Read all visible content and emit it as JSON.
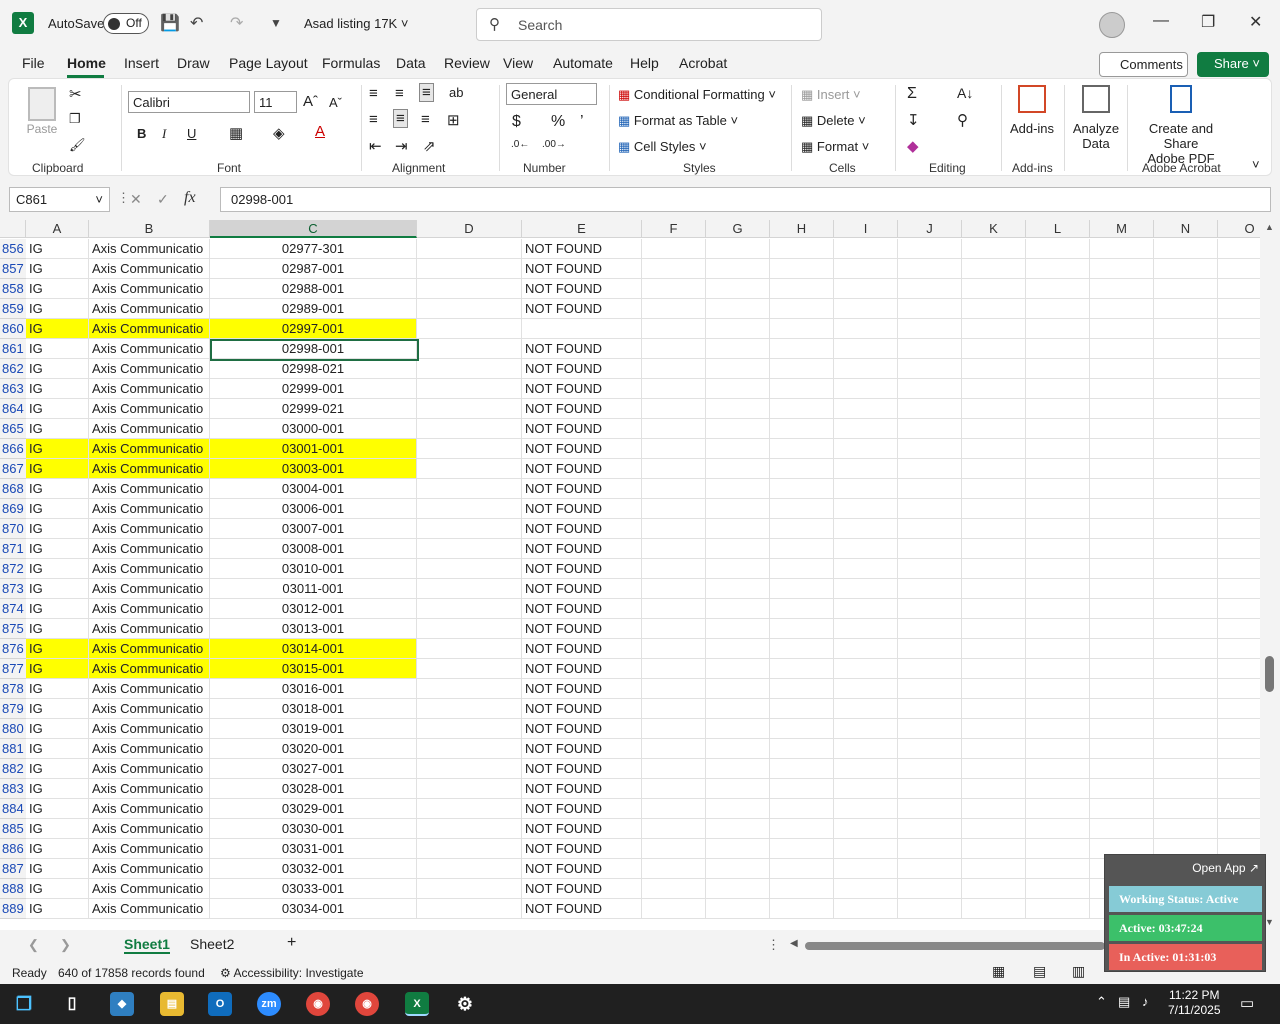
{
  "titlebar": {
    "autosave_label": "AutoSave",
    "autosave_state": "Off",
    "doc_name": "Asad listing 17K",
    "search_placeholder": "Search"
  },
  "menu": [
    "File",
    "Home",
    "Insert",
    "Draw",
    "Page Layout",
    "Formulas",
    "Data",
    "Review",
    "View",
    "Automate",
    "Help",
    "Acrobat"
  ],
  "actions": {
    "comments": "Comments",
    "share": "Share"
  },
  "ribbon": {
    "clipboard": {
      "paste": "Paste",
      "label": "Clipboard"
    },
    "font": {
      "name": "Calibri",
      "size": "11",
      "label": "Font",
      "bold": "B",
      "italic": "I",
      "underline": "U"
    },
    "alignment": {
      "label": "Alignment"
    },
    "number": {
      "format": "General",
      "label": "Number"
    },
    "styles": {
      "conditional": "Conditional Formatting",
      "table": "Format as Table",
      "cell_styles": "Cell Styles",
      "label": "Styles"
    },
    "cells": {
      "insert": "Insert",
      "delete": "Delete",
      "format": "Format",
      "label": "Cells"
    },
    "editing": {
      "label": "Editing"
    },
    "addins": {
      "button": "Add-ins",
      "label": "Add-ins"
    },
    "analyze": {
      "line1": "Analyze",
      "line2": "Data"
    },
    "acrobat": {
      "line1": "Create and Share",
      "line2": "Adobe PDF",
      "label": "Adobe Acrobat"
    }
  },
  "formula": {
    "name_box": "C861",
    "value": "02998-001"
  },
  "columns": [
    "A",
    "B",
    "C",
    "D",
    "E",
    "F",
    "G",
    "H",
    "I",
    "J",
    "K",
    "L",
    "M",
    "N",
    "O"
  ],
  "rows": [
    {
      "n": "856",
      "a": "IG",
      "b": "Axis Communicatio",
      "c": "02977-301",
      "e": "NOT FOUND",
      "hl": false
    },
    {
      "n": "857",
      "a": "IG",
      "b": "Axis Communicatio",
      "c": "02987-001",
      "e": "NOT FOUND",
      "hl": false
    },
    {
      "n": "858",
      "a": "IG",
      "b": "Axis Communicatio",
      "c": "02988-001",
      "e": "NOT FOUND",
      "hl": false
    },
    {
      "n": "859",
      "a": "IG",
      "b": "Axis Communicatio",
      "c": "02989-001",
      "e": "NOT FOUND",
      "hl": false
    },
    {
      "n": "860",
      "a": "IG",
      "b": "Axis Communicatio",
      "c": "02997-001",
      "e": "",
      "hl": true
    },
    {
      "n": "861",
      "a": "IG",
      "b": "Axis Communicatio",
      "c": "02998-001",
      "e": "NOT FOUND",
      "hl": false
    },
    {
      "n": "862",
      "a": "IG",
      "b": "Axis Communicatio",
      "c": "02998-021",
      "e": "NOT FOUND",
      "hl": false
    },
    {
      "n": "863",
      "a": "IG",
      "b": "Axis Communicatio",
      "c": "02999-001",
      "e": "NOT FOUND",
      "hl": false
    },
    {
      "n": "864",
      "a": "IG",
      "b": "Axis Communicatio",
      "c": "02999-021",
      "e": "NOT FOUND",
      "hl": false
    },
    {
      "n": "865",
      "a": "IG",
      "b": "Axis Communicatio",
      "c": "03000-001",
      "e": "NOT FOUND",
      "hl": false
    },
    {
      "n": "866",
      "a": "IG",
      "b": "Axis Communicatio",
      "c": "03001-001",
      "e": "NOT FOUND",
      "hl": true
    },
    {
      "n": "867",
      "a": "IG",
      "b": "Axis Communicatio",
      "c": "03003-001",
      "e": "NOT FOUND",
      "hl": true
    },
    {
      "n": "868",
      "a": "IG",
      "b": "Axis Communicatio",
      "c": "03004-001",
      "e": "NOT FOUND",
      "hl": false
    },
    {
      "n": "869",
      "a": "IG",
      "b": "Axis Communicatio",
      "c": "03006-001",
      "e": "NOT FOUND",
      "hl": false
    },
    {
      "n": "870",
      "a": "IG",
      "b": "Axis Communicatio",
      "c": "03007-001",
      "e": "NOT FOUND",
      "hl": false
    },
    {
      "n": "871",
      "a": "IG",
      "b": "Axis Communicatio",
      "c": "03008-001",
      "e": "NOT FOUND",
      "hl": false
    },
    {
      "n": "872",
      "a": "IG",
      "b": "Axis Communicatio",
      "c": "03010-001",
      "e": "NOT FOUND",
      "hl": false
    },
    {
      "n": "873",
      "a": "IG",
      "b": "Axis Communicatio",
      "c": "03011-001",
      "e": "NOT FOUND",
      "hl": false
    },
    {
      "n": "874",
      "a": "IG",
      "b": "Axis Communicatio",
      "c": "03012-001",
      "e": "NOT FOUND",
      "hl": false
    },
    {
      "n": "875",
      "a": "IG",
      "b": "Axis Communicatio",
      "c": "03013-001",
      "e": "NOT FOUND",
      "hl": false
    },
    {
      "n": "876",
      "a": "IG",
      "b": "Axis Communicatio",
      "c": "03014-001",
      "e": "NOT FOUND",
      "hl": true
    },
    {
      "n": "877",
      "a": "IG",
      "b": "Axis Communicatio",
      "c": "03015-001",
      "e": "NOT FOUND",
      "hl": true
    },
    {
      "n": "878",
      "a": "IG",
      "b": "Axis Communicatio",
      "c": "03016-001",
      "e": "NOT FOUND",
      "hl": false
    },
    {
      "n": "879",
      "a": "IG",
      "b": "Axis Communicatio",
      "c": "03018-001",
      "e": "NOT FOUND",
      "hl": false
    },
    {
      "n": "880",
      "a": "IG",
      "b": "Axis Communicatio",
      "c": "03019-001",
      "e": "NOT FOUND",
      "hl": false
    },
    {
      "n": "881",
      "a": "IG",
      "b": "Axis Communicatio",
      "c": "03020-001",
      "e": "NOT FOUND",
      "hl": false
    },
    {
      "n": "882",
      "a": "IG",
      "b": "Axis Communicatio",
      "c": "03027-001",
      "e": "NOT FOUND",
      "hl": false
    },
    {
      "n": "883",
      "a": "IG",
      "b": "Axis Communicatio",
      "c": "03028-001",
      "e": "NOT FOUND",
      "hl": false
    },
    {
      "n": "884",
      "a": "IG",
      "b": "Axis Communicatio",
      "c": "03029-001",
      "e": "NOT FOUND",
      "hl": false
    },
    {
      "n": "885",
      "a": "IG",
      "b": "Axis Communicatio",
      "c": "03030-001",
      "e": "NOT FOUND",
      "hl": false
    },
    {
      "n": "886",
      "a": "IG",
      "b": "Axis Communicatio",
      "c": "03031-001",
      "e": "NOT FOUND",
      "hl": false
    },
    {
      "n": "887",
      "a": "IG",
      "b": "Axis Communicatio",
      "c": "03032-001",
      "e": "NOT FOUND",
      "hl": false
    },
    {
      "n": "888",
      "a": "IG",
      "b": "Axis Communicatio",
      "c": "03033-001",
      "e": "NOT FOUND",
      "hl": false
    },
    {
      "n": "889",
      "a": "IG",
      "b": "Axis Communicatio",
      "c": "03034-001",
      "e": "NOT FOUND",
      "hl": false
    }
  ],
  "sheets": [
    "Sheet1",
    "Sheet2"
  ],
  "status": {
    "ready": "Ready",
    "records": "640 of 17858 records found",
    "accessibility": "Accessibility: Investigate"
  },
  "widget": {
    "open_app": "Open App",
    "working": "Working Status: Active",
    "active": "Active: 03:47:24",
    "inactive": "In Active: 01:31:03"
  },
  "clock": {
    "time": "11:22 PM",
    "date": "7/11/2025"
  },
  "colors": {
    "excel_green": "#107c41",
    "highlight": "#ffff00",
    "row_number": "#1a49b6"
  }
}
